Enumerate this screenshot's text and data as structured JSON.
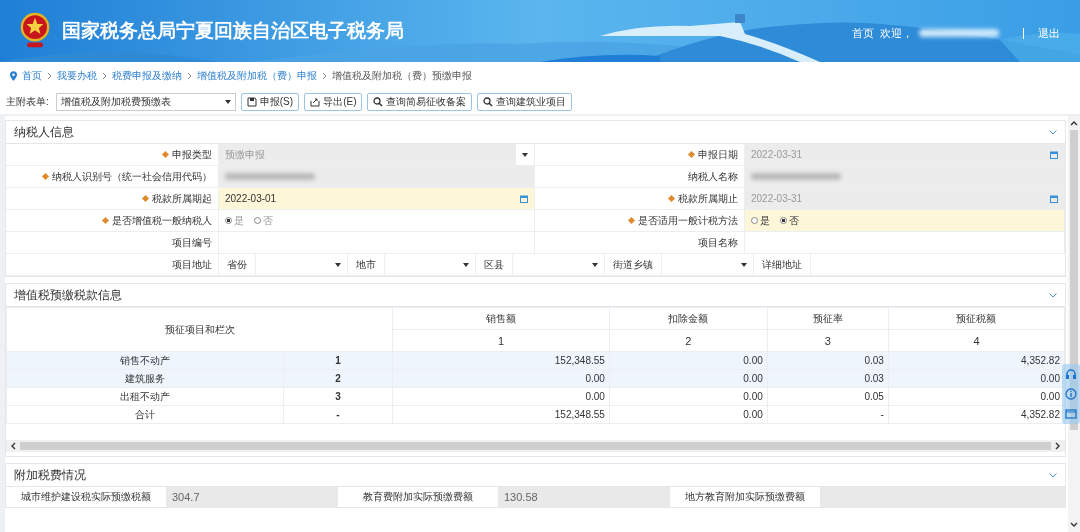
{
  "header": {
    "title": "国家税务总局宁夏回族自治区电子税务局",
    "home": "首页",
    "welcome": "欢迎，",
    "user_hidden": true,
    "logout": "退出"
  },
  "breadcrumb": [
    {
      "label": "首页",
      "current": false
    },
    {
      "label": "我要办税",
      "current": false
    },
    {
      "label": "税费申报及缴纳",
      "current": false
    },
    {
      "label": "增值税及附加税（费）申报",
      "current": false
    },
    {
      "label": "增值税及附加税（费）预缴申报",
      "current": true
    }
  ],
  "toolbar": {
    "form_label": "主附表单:",
    "form_select": "增值税及附加税费预缴表",
    "buttons": [
      {
        "label": "申报(S)"
      },
      {
        "label": "导出(E)"
      },
      {
        "label": "查询简易征收备案"
      },
      {
        "label": "查询建筑业项目"
      }
    ]
  },
  "taxpayer": {
    "title": "纳税人信息",
    "rows": [
      {
        "left": {
          "label": "申报类型",
          "required": true,
          "kind": "select",
          "value": "预缴申报",
          "disabled": true,
          "highlighted": false
        },
        "right": {
          "label": "申报日期",
          "required": true,
          "kind": "date",
          "value": "2022-03-31",
          "disabled": true,
          "highlighted": false
        }
      },
      {
        "left": {
          "label": "纳税人识别号（统一社会信用代码）",
          "required": true,
          "kind": "redacted",
          "disabled": true,
          "highlighted": false
        },
        "right": {
          "label": "纳税人名称",
          "required": false,
          "kind": "redacted",
          "disabled": true,
          "highlighted": false
        }
      },
      {
        "left": {
          "label": "税款所属期起",
          "required": true,
          "kind": "date",
          "value": "2022-03-01",
          "disabled": false,
          "highlighted": true
        },
        "right": {
          "label": "税款所属期止",
          "required": true,
          "kind": "date",
          "value": "2022-03-31",
          "disabled": true,
          "highlighted": false
        }
      },
      {
        "left": {
          "label": "是否增值税一般纳税人",
          "required": true,
          "kind": "radio",
          "disabled": true,
          "highlighted": false,
          "options": [
            {
              "label": "是",
              "selected": true
            },
            {
              "label": "否",
              "selected": false
            }
          ]
        },
        "right": {
          "label": "是否适用一般计税方法",
          "required": true,
          "kind": "radio",
          "disabled": false,
          "highlighted": true,
          "options": [
            {
              "label": "是",
              "selected": false
            },
            {
              "label": "否",
              "selected": true
            }
          ]
        }
      },
      {
        "left": {
          "label": "项目编号",
          "required": false,
          "kind": "text",
          "disabled": false,
          "highlighted": false
        },
        "right": {
          "label": "项目名称",
          "required": false,
          "kind": "text",
          "disabled": false,
          "highlighted": false
        }
      }
    ],
    "address": {
      "label": "项目地址",
      "parts": [
        {
          "label": "省份",
          "kind": "select"
        },
        {
          "label": "地市",
          "kind": "select"
        },
        {
          "label": "区县",
          "kind": "select"
        },
        {
          "label": "街道乡镇",
          "kind": "select"
        },
        {
          "label": "详细地址",
          "kind": "text"
        }
      ]
    }
  },
  "prepay": {
    "title": "增值税预缴税款信息",
    "row_header_label": "预征项目和栏次",
    "columns": [
      {
        "label": "销售额",
        "index": "1"
      },
      {
        "label": "扣除金额",
        "index": "2"
      },
      {
        "label": "预征率",
        "index": "3"
      },
      {
        "label": "预征税额",
        "index": "4"
      }
    ],
    "rows": [
      {
        "selected": true,
        "item": "销售不动产",
        "line": "1",
        "cells": [
          "152,348.55",
          "0.00",
          "0.03",
          "4,352.82"
        ]
      },
      {
        "selected": true,
        "item": "建筑服务",
        "line": "2",
        "cells": [
          "0.00",
          "0.00",
          "0.03",
          "0.00"
        ]
      },
      {
        "selected": false,
        "item": "出租不动产",
        "line": "3",
        "cells": [
          "0.00",
          "0.00",
          "0.05",
          "0.00"
        ]
      },
      {
        "selected": false,
        "item": "合计",
        "line": "-",
        "cells": [
          "152,348.55",
          "0.00",
          "-",
          "4,352.82"
        ]
      }
    ]
  },
  "surcharge": {
    "title": "附加税费情况",
    "fields": [
      {
        "label": "城市维护建设税实际预缴税额",
        "value": "304.7"
      },
      {
        "label": "教育费附加实际预缴费额",
        "value": "130.58"
      },
      {
        "label": "地方教育附加实际预缴费额"
      }
    ]
  }
}
